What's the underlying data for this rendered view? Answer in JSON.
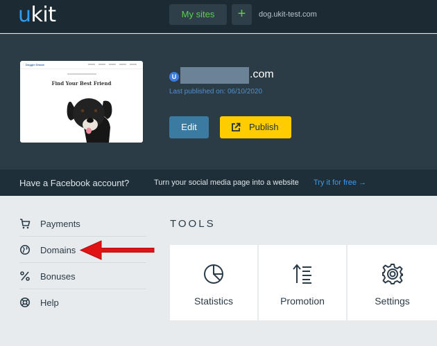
{
  "header": {
    "logo": {
      "first": "u",
      "rest": "kit"
    },
    "my_sites_label": "My sites",
    "add_label": "+",
    "domain": "dog.ukit-test.com"
  },
  "site": {
    "thumbnail": {
      "brand": "Doggie Drame",
      "headline": "Find Your Best Friend"
    },
    "icon_letter": "U",
    "url_suffix": ".com",
    "last_published": "Last published on: 06/10/2020",
    "edit_label": "Edit",
    "publish_label": "Publish"
  },
  "facebook_banner": {
    "question": "Have a Facebook account?",
    "description": "Turn your social media page into a website",
    "cta": "Try it for free →"
  },
  "sidebar": {
    "items": [
      {
        "label": "Payments",
        "icon": "cart-icon"
      },
      {
        "label": "Domains",
        "icon": "domains-icon"
      },
      {
        "label": "Bonuses",
        "icon": "percent-icon"
      },
      {
        "label": "Help",
        "icon": "lifebuoy-icon"
      }
    ]
  },
  "tools": {
    "title": "TOOLS",
    "items": [
      {
        "label": "Statistics",
        "icon": "pie-chart-icon"
      },
      {
        "label": "Promotion",
        "icon": "sort-arrow-icon"
      },
      {
        "label": "Settings",
        "icon": "gear-icon"
      }
    ]
  },
  "colors": {
    "accent_blue": "#2f9cf0",
    "accent_green": "#5ccf4e",
    "publish_yellow": "#ffcc00",
    "annotation_red": "#e01414"
  }
}
